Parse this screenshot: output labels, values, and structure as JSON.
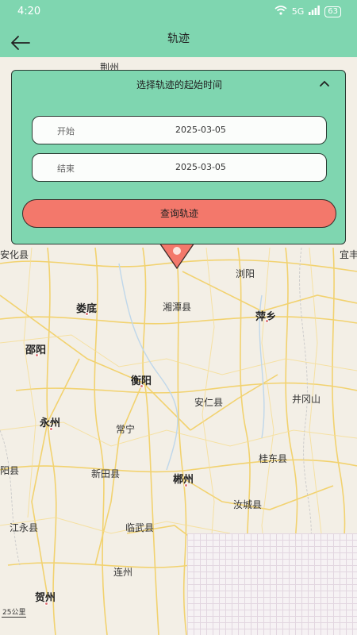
{
  "status_bar": {
    "time": "4:20",
    "signal_text": "5G",
    "battery": "63"
  },
  "header": {
    "title": "轨迹"
  },
  "panel": {
    "title": "选择轨迹的起始时间",
    "start_label": "开始",
    "start_value": "2025-03-05",
    "end_label": "结束",
    "end_value": "2025-03-05",
    "query_button": "查询轨迹"
  },
  "map": {
    "scale_label": "25公里",
    "cities": [
      "荆州",
      "安化县",
      "宜丰",
      "浏阳",
      "娄底",
      "湘潭县",
      "萍乡",
      "邵阳",
      "衡阳",
      "安仁县",
      "井冈山",
      "永州",
      "常宁",
      "新田县",
      "郴州",
      "桂东县",
      "汝城县",
      "江永县",
      "临武县",
      "连州",
      "贺州",
      "阳县"
    ]
  },
  "colors": {
    "accent": "#7fd6b0",
    "button": "#f3786b",
    "road": "#f2cf63"
  }
}
